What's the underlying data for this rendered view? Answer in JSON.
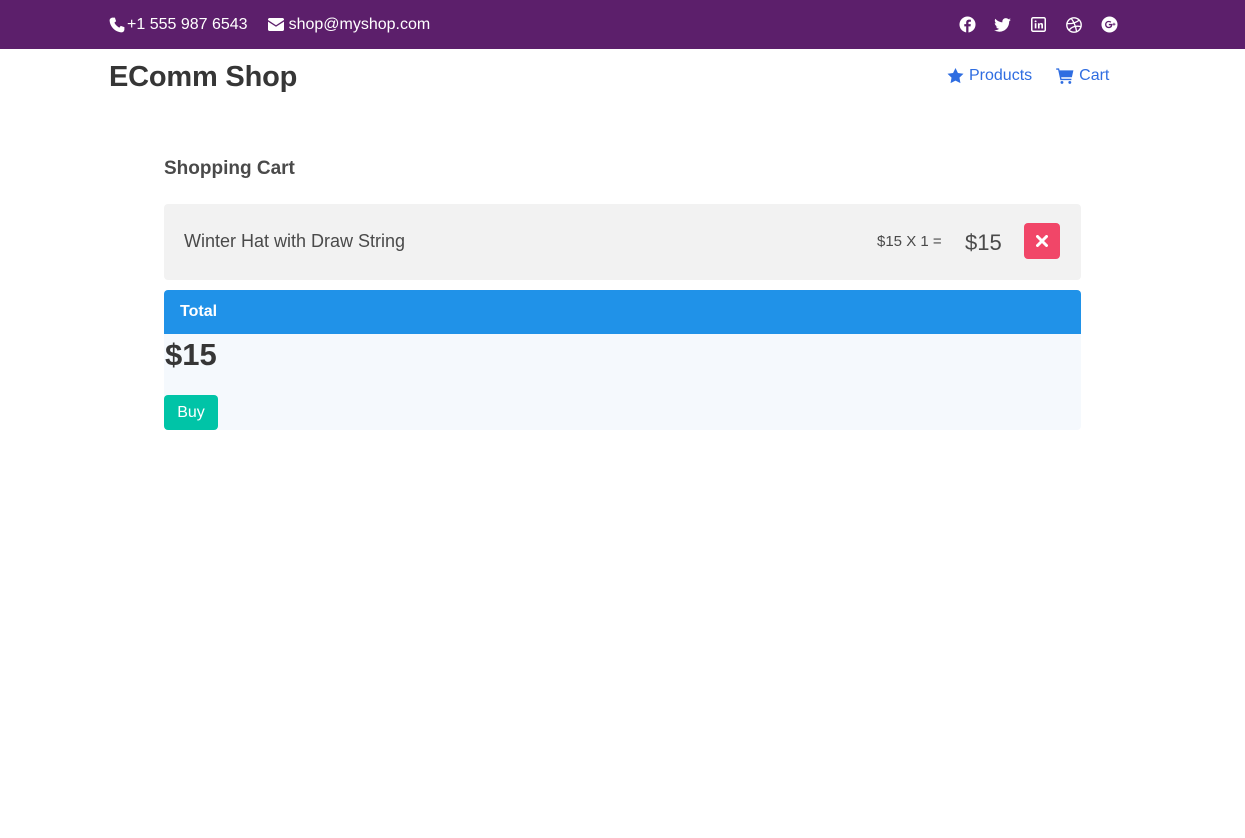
{
  "topbar": {
    "phone": "+1 555 987 6543",
    "email": "shop@myshop.com",
    "social_icons": [
      "facebook-icon",
      "twitter-icon",
      "linkedin-icon",
      "dribbble-icon",
      "google-plus-icon"
    ],
    "background_color": "#5c1f6b"
  },
  "navbar": {
    "brand": "EComm Shop",
    "links": [
      {
        "label": "Products",
        "icon": "star-icon"
      },
      {
        "label": "Cart",
        "icon": "shopping-cart-icon"
      }
    ],
    "link_color": "#2f6de1"
  },
  "cart": {
    "title": "Shopping Cart",
    "items": [
      {
        "name": "Winter Hat with Draw String",
        "calculation": "$15 X 1 =",
        "subtotal": "$15",
        "remove_icon": "close-icon"
      }
    ],
    "total_label": "Total",
    "total_amount": "$15",
    "buy_label": "Buy",
    "colors": {
      "remove": "#f14668",
      "total_header": "#2092e8",
      "buy": "#00c4a7"
    }
  }
}
